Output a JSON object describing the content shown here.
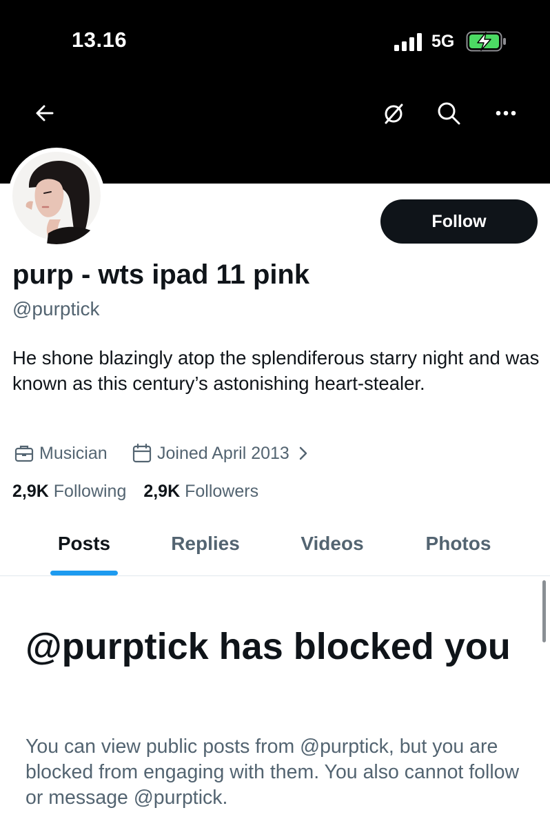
{
  "status_bar": {
    "time": "13.16",
    "network": "5G",
    "icons": [
      "signal-icon",
      "battery-charging-icon"
    ]
  },
  "header": {
    "icons": [
      "back-arrow-icon",
      "grok-icon",
      "search-icon",
      "more-icon"
    ]
  },
  "profile": {
    "name": "purp - wts ipad 11 pink",
    "handle": "@purptick",
    "bio": "He shone blazingly atop the splendiferous starry night and was known as this century’s astonishing heart-stealer.",
    "category": "Musician",
    "joined": "Joined April 2013",
    "follow_label": "Follow",
    "following_count": "2,9K",
    "following_label": "Following",
    "followers_count": "2,9K",
    "followers_label": "Followers"
  },
  "tabs": [
    {
      "label": "Posts",
      "active": true
    },
    {
      "label": "Replies",
      "active": false
    },
    {
      "label": "Videos",
      "active": false
    },
    {
      "label": "Photos",
      "active": false
    }
  ],
  "blocked": {
    "title": "@purptick has blocked you",
    "message": "You can view public posts from @purptick, but you are blocked from engaging with them. You also cannot follow or message @purptick."
  },
  "colors": {
    "accent": "#1d9bf0",
    "text_primary": "#0f1419",
    "text_secondary": "#536471",
    "header_bg": "#000000",
    "battery_charge": "#4cd964"
  }
}
